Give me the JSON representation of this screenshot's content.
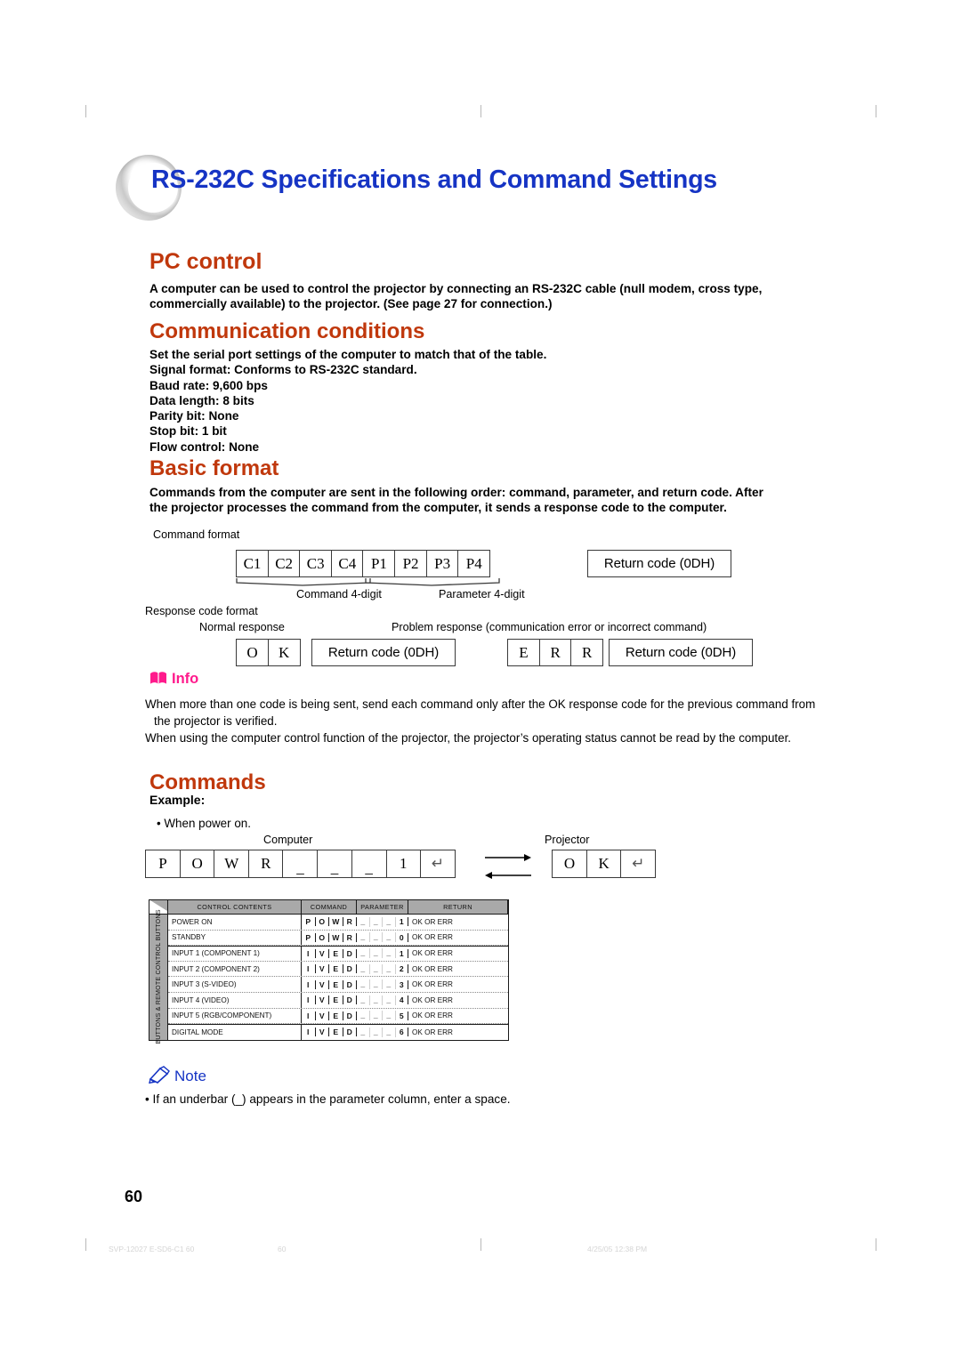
{
  "document": {
    "title": "RS-232C Specifications and Command Settings",
    "page_number": "60",
    "footer_left": "SVP-12027 E-SD6-C1  60",
    "footer_center": "60",
    "footer_right": "4/25/05  12:38 PM"
  },
  "sections": {
    "pc_control": {
      "heading": "PC control",
      "paragraph": [
        "A computer can be used to control the projector by connecting an RS-232C cable (null modem, cross type,",
        "commercially available) to the projector. (See page 27 for connection.)"
      ]
    },
    "communication_conditions": {
      "heading": "Communication conditions",
      "lines": [
        "Set the serial port settings of the computer to match that of the table.",
        "Signal format: Conforms to RS-232C standard.",
        "Baud rate: 9,600 bps",
        "Data length: 8 bits",
        "Parity bit: None",
        "Stop bit: 1 bit",
        "Flow control: None"
      ]
    },
    "basic_format": {
      "heading": "Basic format",
      "paragraph": [
        "Commands from the computer are sent in the following order: command, parameter, and return code. After",
        "the projector processes the command from the computer, it sends a response code to the computer."
      ],
      "command_format_label": "Command format",
      "command_cells": [
        "C1",
        "C2",
        "C3",
        "C4",
        "P1",
        "P2",
        "P3",
        "P4"
      ],
      "return_code_label": "Return code (0DH)",
      "brace_command_label": "Command 4-digit",
      "brace_parameter_label": "Parameter 4-digit",
      "response_code_label": "Response code format",
      "normal_response_label": "Normal response",
      "problem_response_label": "Problem response (communication error or incorrect command)",
      "ok_cells": [
        "O",
        "K"
      ],
      "err_cells": [
        "E",
        "R",
        "R"
      ]
    },
    "info": {
      "label": "Info",
      "bullets": [
        "When more than one code is being sent, send each command only after the OK response code for the previous command from the projector is verified.",
        "When using the computer control function of the projector, the projector’s operating status cannot be read by the computer."
      ]
    },
    "commands": {
      "heading": "Commands",
      "example_label": "Example:",
      "example_bullet": "When power on.",
      "computer_label": "Computer",
      "projector_label": "Projector",
      "computer_cells": [
        "P",
        "O",
        "W",
        "R",
        "_",
        "_",
        "_",
        "1",
        "↵"
      ],
      "projector_cells": [
        "O",
        "K",
        "↵"
      ]
    },
    "note": {
      "label": "Note",
      "bullet": "If an underbar (_)  appears in the parameter column, enter a space."
    }
  },
  "command_table": {
    "side_label": "BUTTONS & REMOTE CONTROL BUTTONS",
    "headers": {
      "control_contents": "CONTROL CONTENTS",
      "command": "COMMAND",
      "parameter": "PARAMETER",
      "return": "RETURN"
    },
    "rows": [
      {
        "name": "POWER ON",
        "command": [
          "P",
          "O",
          "W",
          "R"
        ],
        "parameter": [
          "_",
          "_",
          "_",
          "1"
        ],
        "return": "OK OR ERR",
        "group": 1
      },
      {
        "name": "STANDBY",
        "command": [
          "P",
          "O",
          "W",
          "R"
        ],
        "parameter": [
          "_",
          "_",
          "_",
          "0"
        ],
        "return": "OK OR ERR",
        "group": 1
      },
      {
        "name": "INPUT 1 (COMPONENT 1)",
        "command": [
          "I",
          "V",
          "E",
          "D"
        ],
        "parameter": [
          "_",
          "_",
          "_",
          "1"
        ],
        "return": "OK OR ERR",
        "group": 2
      },
      {
        "name": "INPUT 2 (COMPONENT 2)",
        "command": [
          "I",
          "V",
          "E",
          "D"
        ],
        "parameter": [
          "_",
          "_",
          "_",
          "2"
        ],
        "return": "OK OR ERR",
        "group": 2
      },
      {
        "name": "INPUT 3 (S-VIDEO)",
        "command": [
          "I",
          "V",
          "E",
          "D"
        ],
        "parameter": [
          "_",
          "_",
          "_",
          "3"
        ],
        "return": "OK OR ERR",
        "group": 2
      },
      {
        "name": "INPUT 4 (VIDEO)",
        "command": [
          "I",
          "V",
          "E",
          "D"
        ],
        "parameter": [
          "_",
          "_",
          "_",
          "4"
        ],
        "return": "OK OR ERR",
        "group": 2
      },
      {
        "name": "INPUT 5 (RGB/COMPONENT)",
        "command": [
          "I",
          "V",
          "E",
          "D"
        ],
        "parameter": [
          "_",
          "_",
          "_",
          "5"
        ],
        "return": "OK OR ERR",
        "group": 2
      },
      {
        "name": "DIGITAL MODE",
        "command": [
          "I",
          "V",
          "E",
          "D"
        ],
        "parameter": [
          "_",
          "_",
          "_",
          "6"
        ],
        "return": "OK OR ERR",
        "group": 3
      }
    ]
  },
  "colors": {
    "title_blue": "#1634c4",
    "heading_orange": "#c0380c",
    "info_pink": "#ff1a8c",
    "note_blue": "#1634c4",
    "table_header_gray": "#a9a9a9"
  }
}
